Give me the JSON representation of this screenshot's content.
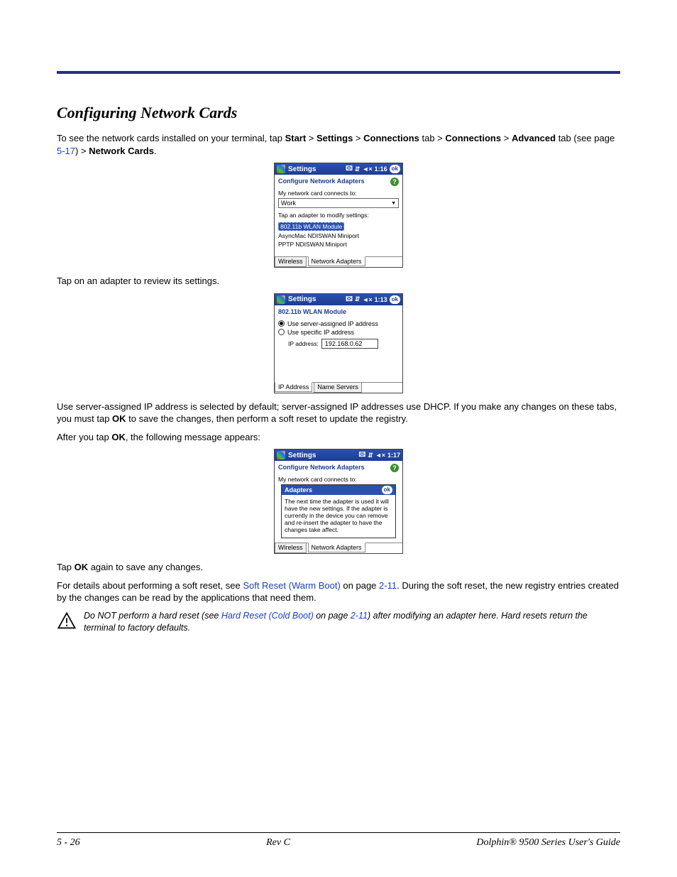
{
  "section_title": "Configuring Network Cards",
  "intro": {
    "pre": "To see the network cards installed on your terminal, tap ",
    "path": [
      "Start",
      "Settings",
      "Connections",
      "Connections",
      "Advanced"
    ],
    "path_suffix_labels": [
      " > ",
      " > ",
      " tab > ",
      " > ",
      " tab (see page "
    ],
    "page_ref": "5-17",
    "post": ") > ",
    "last_crumb": "Network Cards",
    "end": "."
  },
  "shot1": {
    "title": "Settings",
    "time": "1:16",
    "subtitle": "Configure Network Adapters",
    "connects_label": "My network card connects to:",
    "connects_value": "Work",
    "modify_label": "Tap an adapter to modify settings:",
    "adapters": [
      "802.11b WLAN Module",
      "AsyncMac NDISWAN Miniport",
      "PPTP NDISWAN Miniport"
    ],
    "tabs": [
      "Wireless",
      "Network Adapters"
    ]
  },
  "after_shot1": "Tap on an adapter to review its settings.",
  "shot2": {
    "title": "Settings",
    "time": "1:13",
    "subtitle": "802.11b WLAN Module",
    "radio_server": "Use server-assigned IP address",
    "radio_specific": "Use specific IP address",
    "ip_label": "IP address:",
    "ip_value": "192.168.0.62",
    "tabs": [
      "IP Address",
      "Name Servers"
    ]
  },
  "para_dhcp_a": "Use server-assigned IP address is selected by default; server-assigned IP addresses use DHCP. If you make any changes on these tabs, you must tap ",
  "para_dhcp_ok": "OK",
  "para_dhcp_b": " to save the changes, then perform a soft reset to update the registry.",
  "para_after_a": "After you tap ",
  "para_after_ok": "OK",
  "para_after_b": ", the following message appears:",
  "shot3": {
    "title": "Settings",
    "time": "1:17",
    "subtitle": "Configure Network Adapters",
    "connects_label": "My network card connects to:",
    "popup_title": "Adapters",
    "popup_body": "The next time the adapter is used it will have the new settings. If the adapter is currently in the device you can remove and re-insert the adapter to have the changes take affect.",
    "tabs": [
      "Wireless",
      "Network Adapters"
    ]
  },
  "tap_again_a": "Tap ",
  "tap_again_ok": "OK",
  "tap_again_b": " again to save any changes.",
  "softreset_a": "For details about performing a soft reset, see ",
  "softreset_link": "Soft Reset (Warm Boot)",
  "softreset_b": " on page ",
  "softreset_page": "2-11",
  "softreset_c": ". During the soft reset, the new registry entries created by the changes can be read by the applications that need them.",
  "warn_a": "Do NOT perform a hard reset (see ",
  "warn_link": "Hard Reset (Cold Boot)",
  "warn_b": " on page ",
  "warn_page": "2-11",
  "warn_c": ") after modifying an adapter here. Hard resets return the terminal to factory defaults.",
  "footer": {
    "left": "5 - 26",
    "center": "Rev C",
    "right": "Dolphin® 9500 Series User's Guide"
  },
  "icons": {
    "ok": "ok",
    "help": "?",
    "speaker": "◄×"
  }
}
